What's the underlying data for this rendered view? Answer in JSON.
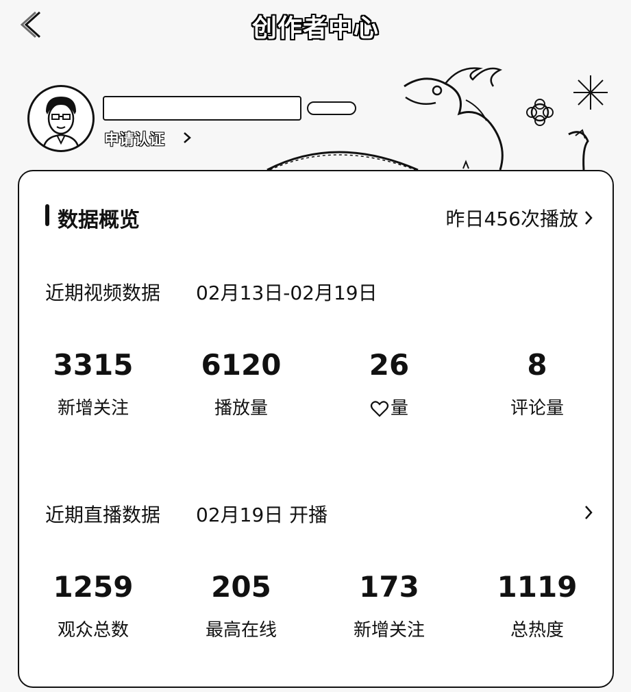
{
  "header": {
    "title": "创作者中心",
    "back_icon": "chevron-left-icon"
  },
  "profile": {
    "cert_link": "申请认证"
  },
  "overview": {
    "title": "数据概览",
    "yesterday_plays": "昨日456次播放"
  },
  "video": {
    "label": "近期视频数据",
    "date_range": "02月13日-02月19日",
    "stats": [
      {
        "value": "3315",
        "label": "新增关注"
      },
      {
        "value": "6120",
        "label": "播放量"
      },
      {
        "value": "26",
        "label": "量",
        "icon": "heart-icon"
      },
      {
        "value": "8",
        "label": "评论量"
      }
    ]
  },
  "live": {
    "label": "近期直播数据",
    "date": "02月19日 开播",
    "stats": [
      {
        "value": "1259",
        "label": "观众总数"
      },
      {
        "value": "205",
        "label": "最高在线"
      },
      {
        "value": "173",
        "label": "新增关注"
      },
      {
        "value": "1119",
        "label": "总热度"
      }
    ]
  }
}
